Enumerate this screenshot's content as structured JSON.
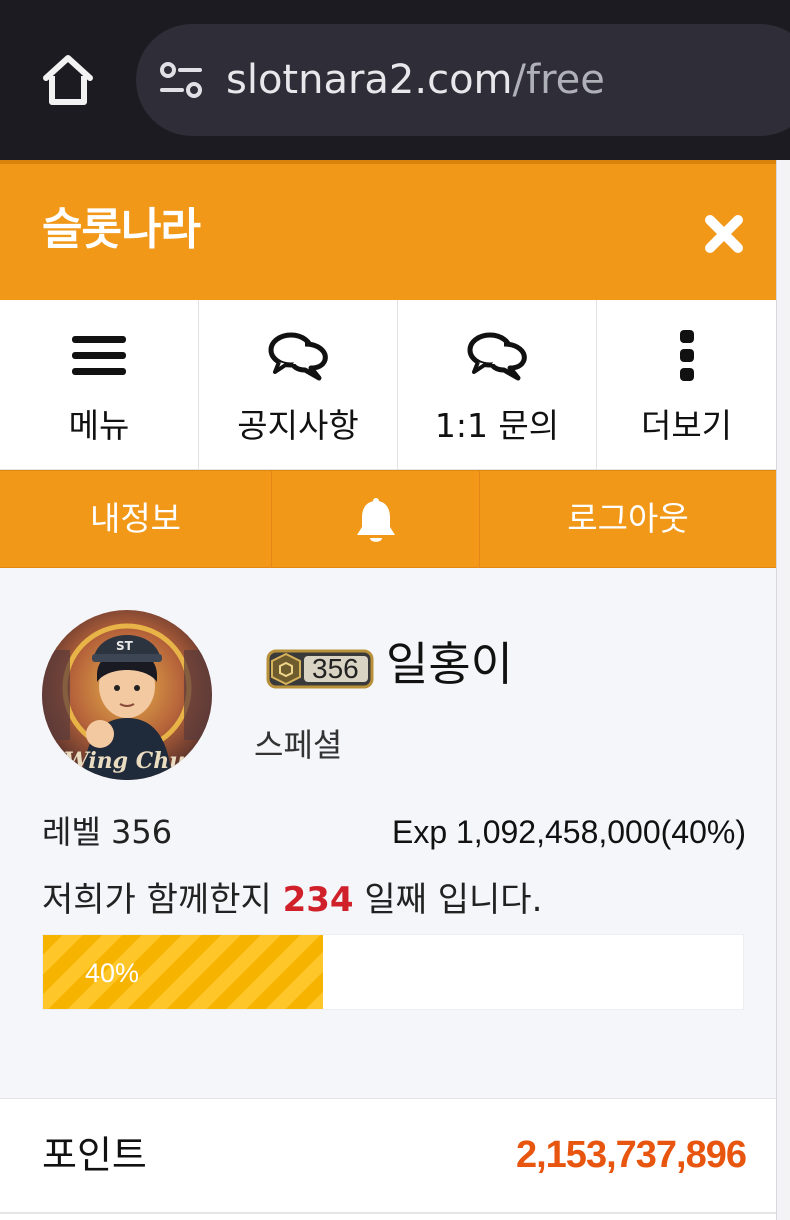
{
  "browser": {
    "url_domain": "slotnara2.com",
    "url_path": "/free",
    "icons": [
      "home-icon",
      "site-settings-icon"
    ]
  },
  "header": {
    "title": "슬롯나라",
    "close_icon": "close-icon"
  },
  "menu": {
    "items": [
      {
        "label": "메뉴",
        "icon": "hamburger-icon"
      },
      {
        "label": "공지사항",
        "icon": "chat-bubbles-icon"
      },
      {
        "label": "1:1 문의",
        "icon": "chat-bubbles-icon"
      },
      {
        "label": "더보기",
        "icon": "more-vertical-icon"
      }
    ]
  },
  "actions": {
    "my_info": "내정보",
    "notification_icon": "bell-icon",
    "logout": "로그아웃"
  },
  "profile": {
    "level_badge": "356",
    "nickname": "일홍이",
    "rank": "스페셜",
    "avatar_caption": "Wing Chun",
    "level_text": "레벨 356",
    "exp_text": "Exp 1,092,458,000(40%)",
    "days_prefix": "저희가 함께한지 ",
    "days_number": "234",
    "days_suffix": " 일째 입니다.",
    "progress_percent": 40,
    "progress_label": "40%"
  },
  "points": {
    "label": "포인트",
    "value": "2,153,737,896"
  },
  "colors": {
    "brand_orange": "#f19819",
    "points_orange": "#e8550f",
    "days_red": "#d0202a",
    "progress_yellow": "#f6b300",
    "browser_dark": "#1c1b22"
  }
}
